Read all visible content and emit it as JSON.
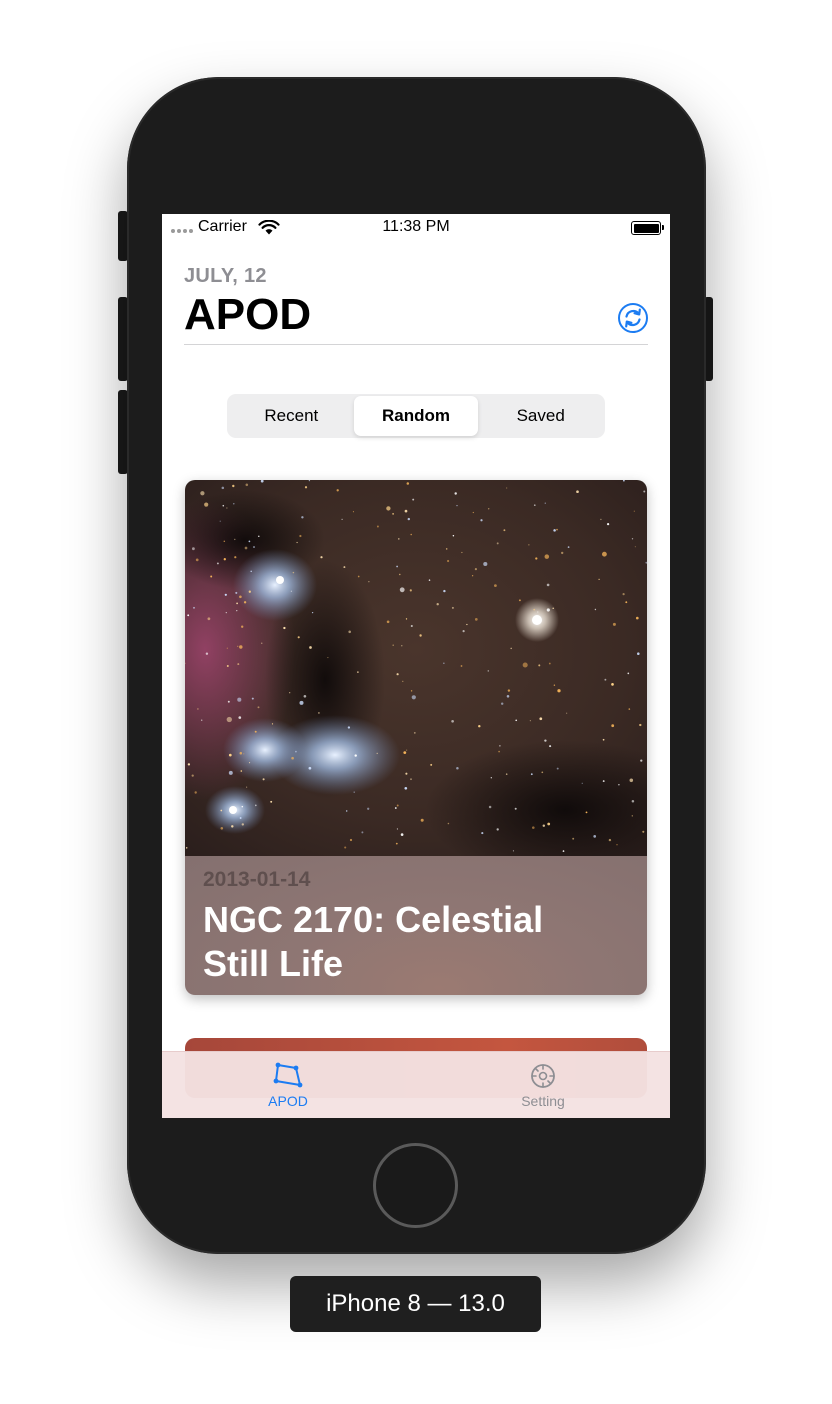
{
  "status_bar": {
    "carrier": "Carrier",
    "time": "11:38 PM"
  },
  "header": {
    "date": "JULY, 12",
    "title": "APOD",
    "refresh_icon": "refresh-icon"
  },
  "segments": [
    {
      "label": "Recent",
      "active": false
    },
    {
      "label": "Random",
      "active": true
    },
    {
      "label": "Saved",
      "active": false
    }
  ],
  "card": {
    "date": "2013-01-14",
    "title": "NGC 2170: Celestial Still Life"
  },
  "tabbar": {
    "items": [
      {
        "label": "APOD",
        "icon": "apod-constellation-icon",
        "active": true
      },
      {
        "label": "Setting",
        "icon": "gear-icon",
        "active": false
      }
    ]
  },
  "device_label": "iPhone 8 — 13.0",
  "colors": {
    "accent": "#1c7cf2",
    "secondary_text": "#8e8e93",
    "tabbar_bg": "#f4e2e2",
    "card_footer": "#8e7673"
  }
}
